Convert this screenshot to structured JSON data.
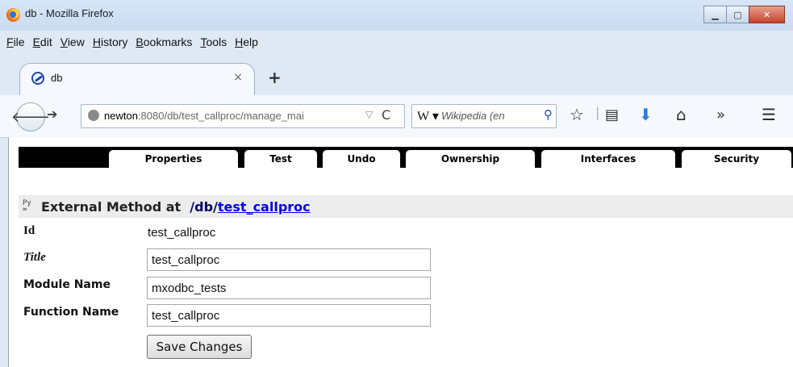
{
  "window": {
    "title": "db - Mozilla Firefox"
  },
  "menu": [
    "File",
    "Edit",
    "View",
    "History",
    "Bookmarks",
    "Tools",
    "Help"
  ],
  "tab": {
    "title": "db",
    "close": "×",
    "new_tab": "+"
  },
  "nav": {
    "url_host": "newton",
    "url_rest": ":8080/db/test_callproc/manage_mai",
    "url_drop": "▽",
    "reload": "C",
    "search_engine": "W",
    "search_placeholder": "Wikipedia (en",
    "search_icon": "⚲",
    "icons": [
      "star-icon",
      "bookmarks-list-icon",
      "downloads-icon",
      "home-icon",
      "overflow-icon",
      "menu-icon"
    ]
  },
  "zmi": {
    "tabs": [
      "Properties",
      "Test",
      "Undo",
      "Ownership",
      "Interfaces",
      "Security"
    ],
    "header_prefix": "External Method at",
    "header_path": "/db/",
    "header_link": "test_callproc",
    "icon_text": "Py",
    "labels": {
      "id": "Id",
      "title": "Title",
      "module": "Module Name",
      "function": "Function Name"
    },
    "id_value": "test_callproc",
    "title_value": "test_callproc",
    "module_value": "mxodbc_tests",
    "function_value": "test_callproc",
    "save_label": "Save Changes"
  }
}
